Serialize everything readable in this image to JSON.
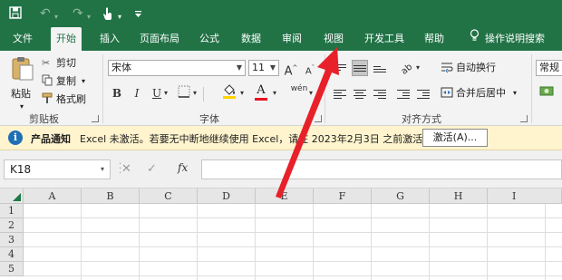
{
  "quick_access": {
    "icons": [
      "save-icon",
      "undo-icon",
      "redo-icon",
      "touch-mode-icon",
      "customize-icon"
    ]
  },
  "tabs": [
    {
      "label": "文件",
      "active": false
    },
    {
      "label": "开始",
      "active": true
    },
    {
      "label": "插入",
      "active": false
    },
    {
      "label": "页面布局",
      "active": false
    },
    {
      "label": "公式",
      "active": false
    },
    {
      "label": "数据",
      "active": false
    },
    {
      "label": "审阅",
      "active": false
    },
    {
      "label": "视图",
      "active": false
    },
    {
      "label": "开发工具",
      "active": false
    },
    {
      "label": "帮助",
      "active": false
    }
  ],
  "tell_me": {
    "label": "操作说明搜索",
    "icon": "lightbulb-icon"
  },
  "ribbon": {
    "clipboard": {
      "paste": "粘贴",
      "cut": "剪切",
      "copy": "复制",
      "format_painter": "格式刷",
      "group_label": "剪贴板"
    },
    "font": {
      "font_name": "宋体",
      "font_size": "11",
      "grow": "A",
      "shrink": "A",
      "bold": "B",
      "italic": "I",
      "underline": "U",
      "underline_dd": "▾",
      "fill_letter": "A",
      "font_color_letter": "A",
      "phonetic": "wén",
      "group_label": "字体"
    },
    "alignment": {
      "wrap_text": "自动换行",
      "merge_center": "合并后居中",
      "merge_dd": "▾",
      "group_label": "对齐方式"
    },
    "number": {
      "format": "常规"
    },
    "colors": {
      "accent": "#217346",
      "font_red": "#e81123",
      "fill_yellow": "#ffd400"
    }
  },
  "message_bar": {
    "icon": "info-icon",
    "info_glyph": "i",
    "title": "产品通知",
    "text": "Excel 未激活。若要无中断地继续使用 Excel，请在 2023年2月3日 之前激活。",
    "button": "激活(A)..."
  },
  "formula_bar": {
    "name_box": "K18",
    "name_dd": "▾",
    "cancel": "✕",
    "enter": "✓",
    "fx": "fx",
    "value": ""
  },
  "sheet": {
    "columns": [
      "A",
      "B",
      "C",
      "D",
      "E",
      "F",
      "G",
      "H",
      "I"
    ],
    "rows": [
      "1",
      "2",
      "3",
      "4",
      "5"
    ]
  },
  "annotation": {
    "arrow_color": "#e8202a"
  }
}
